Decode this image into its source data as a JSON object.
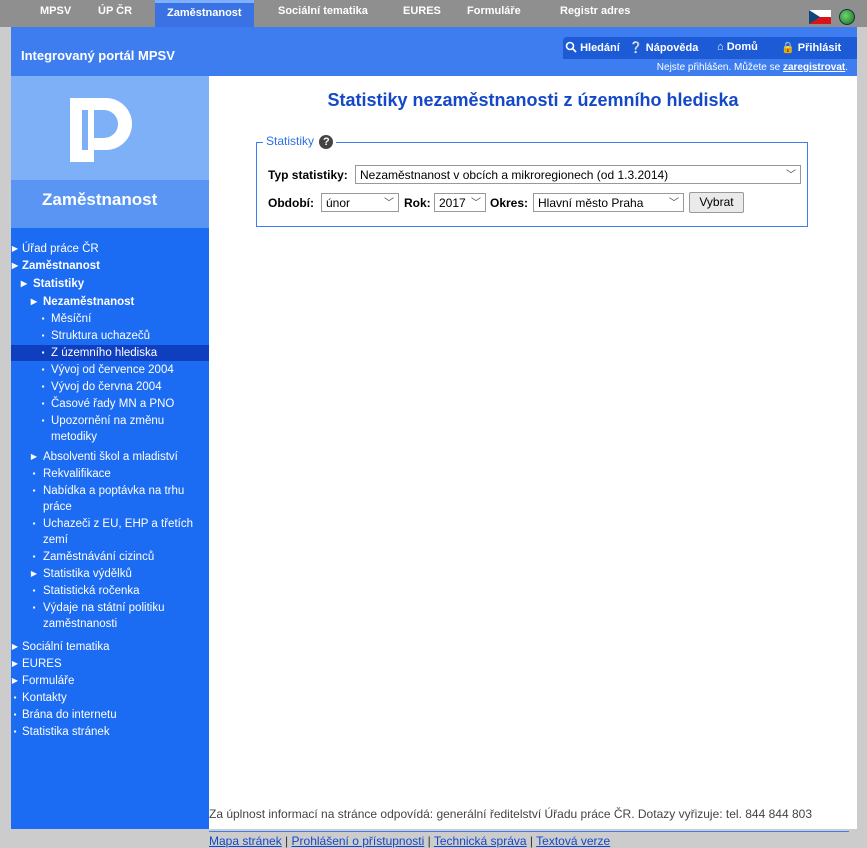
{
  "topnav": {
    "tabs": [
      "MPSV",
      "ÚP ČR",
      "Zaměstnanost",
      "Sociální tematika",
      "EURES",
      "Formuláře",
      "Registr adres"
    ],
    "active": "Zaměstnanost"
  },
  "header": {
    "portal_title": "Integrovaný portál MPSV",
    "nav": {
      "search": "Hledání",
      "help": "Nápověda",
      "home": "Domů",
      "login": "Přihlásit"
    },
    "status_text": "Nejste přihlášen. Můžete se",
    "status_link": "zaregistrovat",
    "status_end": "."
  },
  "sidebar": {
    "brand": "Zaměstnanost",
    "menu": [
      {
        "label": "Úřad práce ČR"
      },
      {
        "label": "Zaměstnanost"
      },
      {
        "label": "Statistiky"
      },
      {
        "label": "Nezaměstnanost"
      },
      {
        "label": "Měsíční"
      },
      {
        "label": "Struktura uchazečů"
      },
      {
        "label": "Z územního hlediska"
      },
      {
        "label": "Vývoj od července 2004"
      },
      {
        "label": "Vývoj do června 2004"
      },
      {
        "label": "Časové řady MN a PNO"
      },
      {
        "label": "Upozornění na změnu"
      },
      {
        "label": "metodiky"
      },
      {
        "label": "Absolventi škol a mladiství"
      },
      {
        "label": "Rekvalifikace"
      },
      {
        "label": "Nabídka a poptávka na trhu"
      },
      {
        "label": "práce"
      },
      {
        "label": "Uchazeči z EU, EHP a třetích"
      },
      {
        "label": "zemí"
      },
      {
        "label": "Zaměstnávání cizinců"
      },
      {
        "label": "Statistika výdělků"
      },
      {
        "label": "Statistická ročenka"
      },
      {
        "label": "Výdaje na státní politiku"
      },
      {
        "label": "zaměstnanosti"
      },
      {
        "label": "Sociální tematika"
      },
      {
        "label": "EURES"
      },
      {
        "label": "Formuláře"
      },
      {
        "label": "Kontakty"
      },
      {
        "label": "Brána do internetu"
      },
      {
        "label": "Statistika stránek"
      }
    ]
  },
  "main": {
    "title": "Statistiky nezaměstnanosti z územního hlediska",
    "legend": "Statistiky",
    "help_glyph": "?",
    "type_label": "Typ statistiky:",
    "type_value": "Nezaměstnanost v obcích a mikroregionech (od 1.3.2014)",
    "period_label": "Období:",
    "period_value": "únor",
    "year_label": "Rok:",
    "year_value": "2017",
    "district_label": "Okres:",
    "district_value": "Hlavní město Praha",
    "submit_label": "Vybrat"
  },
  "footer": {
    "info": "Za úplnost informací na stránce odpovídá: generální ředitelství Úřadu práce ČR. Dotazy vyřizuje: tel. 844 844 803",
    "links": [
      "Mapa stránek",
      "Prohlášení o přístupnosti",
      "Technická správa",
      "Textová verze"
    ],
    "separator": "|"
  },
  "colors": {
    "accent": "#3d7df0",
    "sidebar": "#1c6bf3",
    "title": "#1448c8"
  }
}
